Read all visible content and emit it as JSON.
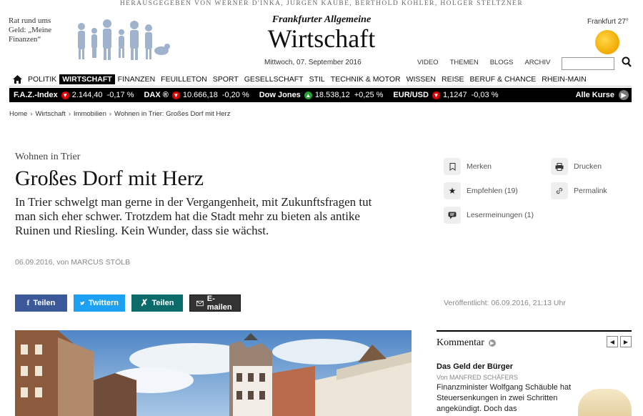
{
  "publisher_line": "HERAUSGEGEBEN VON WERNER D'INKA, JÜRGEN KAUBE, BERTHOLD KOHLER, HOLGER STELTZNER",
  "promo": {
    "text": "Rat rund ums Geld: „Meine Finanzen“"
  },
  "logo": {
    "small": "Frankfurter Allgemeine",
    "big": "Wirtschaft"
  },
  "date": "Mittwoch, 07. September 2016",
  "header_links": [
    "VIDEO",
    "THEMEN",
    "BLOGS",
    "ARCHIV"
  ],
  "search": {
    "value": ""
  },
  "weather": {
    "city_temp": "Frankfurt 27°",
    "icon": "sun-icon"
  },
  "nav": {
    "items": [
      "POLITIK",
      "WIRTSCHAFT",
      "FINANZEN",
      "FEUILLETON",
      "SPORT",
      "GESELLSCHAFT",
      "STIL",
      "TECHNIK & MOTOR",
      "WISSEN",
      "REISE",
      "BERUF & CHANCE",
      "RHEIN-MAIN"
    ],
    "active": "WIRTSCHAFT"
  },
  "ticker": {
    "items": [
      {
        "name": "F.A.Z.-Index",
        "dir": "down",
        "value": "2.144,40",
        "change": "-0,17 %"
      },
      {
        "name": "DAX ®",
        "dir": "down",
        "value": "10.666,18",
        "change": "-0,20 %"
      },
      {
        "name": "Dow Jones",
        "dir": "up",
        "value": "18.538,12",
        "change": "+0,25 %"
      },
      {
        "name": "EUR/USD",
        "dir": "down",
        "value": "1,1247",
        "change": "-0,03 %"
      }
    ],
    "more_label": "Alle Kurse"
  },
  "breadcrumb": [
    "Home",
    "Wirtschaft",
    "Immobilien",
    "Wohnen in Trier: Großes Dorf mit Herz"
  ],
  "article": {
    "kicker": "Wohnen in Trier",
    "headline": "Großes Dorf mit Herz",
    "teaser": "In Trier schwelgt man gerne in der Vergangenheit, mit Zukunftsfragen tut man sich eher schwer. Trotzdem hat die Stadt mehr zu bieten als antike Ruinen und Riesling. Kein Wunder, dass sie wächst.",
    "byline": "06.09.2016, von MARCUS STÖLB",
    "published": "Veröffentlicht: 06.09.2016, 21:13 Uhr"
  },
  "share": {
    "facebook": "Teilen",
    "twitter": "Twittern",
    "xing": "Teilen",
    "email": "E-mailen"
  },
  "actions": {
    "merken": "Merken",
    "drucken": "Drucken",
    "empfehlen": "Empfehlen (19)",
    "permalink": "Permalink",
    "lesermeinungen": "Lesermeinungen (1)"
  },
  "comment_box": {
    "title": "Kommentar",
    "headline": "Das Geld der Bürger",
    "author": "Von MANFRED SCHÄFERS",
    "text": "Finanzminister Wolfgang Schäuble hat Steuersenkungen in zwei Schritten angekündigt. Doch das"
  }
}
